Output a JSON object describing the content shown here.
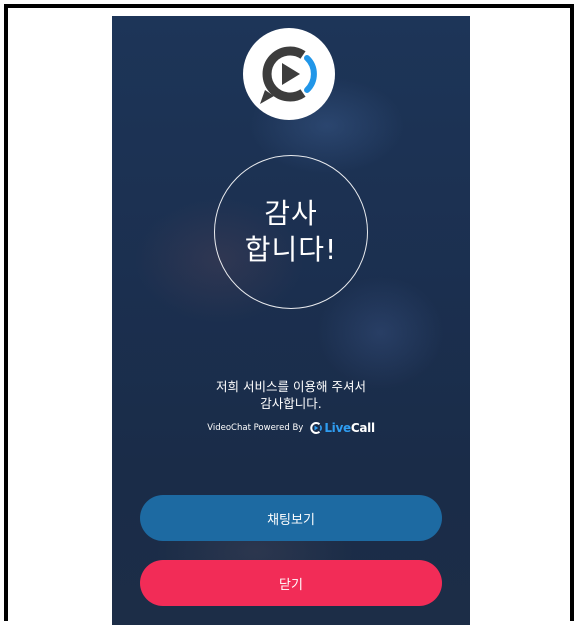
{
  "screen": {
    "title_line1": "감사",
    "title_line2": "합니다!",
    "message_line1": "저희 서비스를 이용해 주셔서",
    "message_line2": "감사합니다.",
    "powered_by": "VideoChat Powered By",
    "brand_live": "Live",
    "brand_call": "Call"
  },
  "buttons": {
    "view_chat_label": "채팅보기",
    "close_label": "닫기"
  },
  "icons": {
    "app_logo": "video-chat-play-logo-icon",
    "brand_logo": "livecall-logo-icon"
  },
  "colors": {
    "background": "#1b2f4f",
    "chat_button": "#1d6aa2",
    "close_button": "#f22c57",
    "brand_blue": "#2f9df1",
    "logo_dark": "#3d3d3d"
  }
}
